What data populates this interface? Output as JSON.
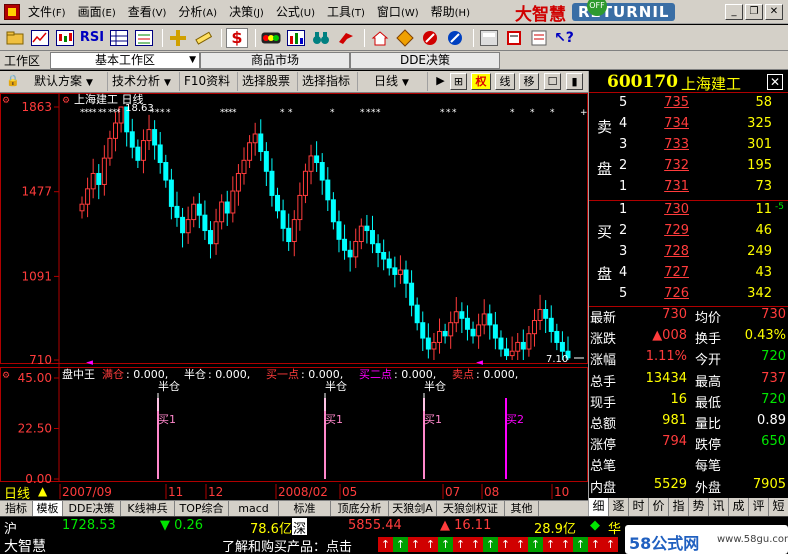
{
  "menu": {
    "items": [
      {
        "label": "文件",
        "key": "(F)"
      },
      {
        "label": "画面",
        "key": "(E)"
      },
      {
        "label": "查看",
        "key": "(V)"
      },
      {
        "label": "分析",
        "key": "(A)"
      },
      {
        "label": "决策",
        "key": "(J)"
      },
      {
        "label": "公式",
        "key": "(U)"
      },
      {
        "label": "工具",
        "key": "(T)"
      },
      {
        "label": "窗口",
        "key": "(W)"
      },
      {
        "label": "帮助",
        "key": "(H)"
      }
    ],
    "brand_text": "大智慧",
    "brand_badge": "RETURNIL",
    "off_badge": "OFF"
  },
  "toolbar": {
    "rsi_label": "RSI",
    "dollar_label": "$"
  },
  "workarea": {
    "label": "工作区",
    "tabs": [
      "基本工作区",
      "商品市场",
      "DDE决策"
    ]
  },
  "chart_toolbar": {
    "buttons": [
      "默认方案",
      "技术分析",
      "F10资料",
      "选择股票",
      "选择指标",
      "日线"
    ],
    "right_buttons": [
      "▶",
      "⊞",
      "权",
      "线",
      "移",
      "☐",
      "▮"
    ]
  },
  "chart_data": [
    {
      "type": "candlestick",
      "title": "上海建工 日线",
      "y_ticks": [
        "1863",
        "1477",
        "1091",
        "710"
      ],
      "x_ticks": [
        "2007/09",
        "11",
        "12",
        "2008/02",
        "05",
        "07",
        "08",
        "10"
      ],
      "annotations": [
        {
          "label": "18.63",
          "at": "high"
        },
        {
          "label": "7.10",
          "at": "low"
        }
      ],
      "ylim": [
        7.1,
        18.63
      ],
      "closes": [
        14.2,
        14.9,
        15.6,
        15.1,
        16.3,
        17.2,
        17.9,
        18.63,
        17.5,
        16.8,
        16.2,
        17.1,
        17.6,
        16.9,
        16.1,
        15.3,
        14.1,
        13.6,
        12.9,
        13.5,
        14.2,
        13.7,
        13.0,
        12.4,
        13.4,
        14.3,
        13.8,
        14.8,
        15.6,
        16.2,
        17.0,
        17.4,
        16.6,
        15.7,
        14.6,
        13.9,
        13.1,
        12.5,
        13.5,
        14.6,
        15.7,
        16.4,
        16.1,
        15.3,
        14.4,
        13.4,
        12.6,
        12.1,
        11.8,
        12.5,
        13.2,
        13.0,
        12.4,
        12.0,
        11.7,
        11.3,
        11.0,
        11.2,
        10.6,
        9.6,
        8.8,
        8.1,
        7.6,
        7.9,
        8.4,
        8.2,
        8.8,
        9.3,
        9.0,
        8.5,
        8.2,
        8.7,
        9.2,
        8.7,
        8.1,
        7.6,
        7.3,
        7.5,
        7.9,
        7.6,
        8.3,
        8.9,
        9.4,
        9.0,
        8.4,
        7.9,
        7.5,
        7.2
      ]
    },
    {
      "type": "bar",
      "title": "盘中王",
      "y_ticks": [
        "45.00",
        "22.50",
        "0.00"
      ],
      "ylim": [
        0,
        45
      ],
      "legend": [
        {
          "name": "满仓",
          "value": "0.000",
          "color": "#ff3c3c"
        },
        {
          "name": "半仓",
          "value": "0.000",
          "color": "#ffffff"
        },
        {
          "name": "买一点",
          "value": "0.000",
          "color": "#ff3c3c"
        },
        {
          "name": "买二点",
          "value": "0.000",
          "color": "#ff00ff"
        },
        {
          "name": "卖点",
          "value": "0.000",
          "color": "#ff3c3c"
        }
      ],
      "markers": [
        {
          "top": "半仓",
          "bottom": "买1",
          "value": 45,
          "color": "#ff88cc"
        },
        {
          "top": "半仓",
          "bottom": "买1",
          "value": 45,
          "color": "#ff88cc"
        },
        {
          "top": "半仓",
          "bottom": "买1",
          "value": 45,
          "color": "#ff88cc"
        },
        {
          "top": "",
          "bottom": "买2",
          "value": 45,
          "color": "#ff00ff"
        }
      ]
    }
  ],
  "bottom_tabs": [
    "指标",
    "模板",
    "DDE决策",
    "K线神兵",
    "TOP综合",
    "macd",
    "标准",
    "顶底分析",
    "天狼剑A",
    "天狼剑权证",
    "其他"
  ],
  "bottom_tabs_active": 1,
  "x_axis_label": "日线",
  "quote": {
    "code": "600170",
    "name": "上海建工",
    "sell_label": [
      "卖",
      "盘"
    ],
    "buy_label": [
      "买",
      "盘"
    ],
    "sells": [
      {
        "level": "5",
        "price": "735",
        "vol": "58"
      },
      {
        "level": "4",
        "price": "734",
        "vol": "325"
      },
      {
        "level": "3",
        "price": "733",
        "vol": "301"
      },
      {
        "level": "2",
        "price": "732",
        "vol": "195"
      },
      {
        "level": "1",
        "price": "731",
        "vol": "73"
      }
    ],
    "buys": [
      {
        "level": "1",
        "price": "730",
        "vol": "11",
        "note": "-5"
      },
      {
        "level": "2",
        "price": "729",
        "vol": "46",
        "note": ""
      },
      {
        "level": "3",
        "price": "728",
        "vol": "249",
        "note": ""
      },
      {
        "level": "4",
        "price": "727",
        "vol": "43",
        "note": ""
      },
      {
        "level": "5",
        "price": "726",
        "vol": "342",
        "note": ""
      }
    ],
    "stats": [
      {
        "k1": "最新",
        "v1": "730",
        "c1": "red",
        "k2": "均价",
        "v2": "730",
        "c2": "red"
      },
      {
        "k1": "涨跌",
        "v1": "▲008",
        "c1": "red",
        "k2": "换手",
        "v2": "0.43%",
        "c2": "yel"
      },
      {
        "k1": "涨幅",
        "v1": "1.11%",
        "c1": "red",
        "k2": "今开",
        "v2": "720",
        "c2": "green"
      },
      {
        "k1": "总手",
        "v1": "13434",
        "c1": "yel",
        "k2": "最高",
        "v2": "737",
        "c2": "red"
      },
      {
        "k1": "现手",
        "v1": "16",
        "c1": "yel",
        "k2": "最低",
        "v2": "720",
        "c2": "green"
      },
      {
        "k1": "总额",
        "v1": "981",
        "c1": "yel",
        "k2": "量比",
        "v2": "0.89",
        "c2": "wht"
      },
      {
        "k1": "涨停",
        "v1": "794",
        "c1": "red",
        "k2": "跌停",
        "v2": "650",
        "c2": "green"
      },
      {
        "k1": "总笔",
        "v1": "",
        "c1": "yel",
        "k2": "每笔",
        "v2": "",
        "c2": "yel"
      },
      {
        "k1": "内盘",
        "v1": "5529",
        "c1": "yel",
        "k2": "外盘",
        "v2": "7905",
        "c2": "yel"
      }
    ],
    "panel_tabs": [
      "细",
      "逐",
      "时",
      "价",
      "指",
      "势",
      "讯",
      "成",
      "评",
      "短"
    ]
  },
  "status": {
    "sh_label": "沪",
    "sh_index": "1728.53",
    "sh_change": "▼ 0.26",
    "sh_amount": "78.6亿",
    "sz_label": "深",
    "sz_index": "5855.44",
    "sz_change": "▲ 16.11",
    "sz_amount": "28.9亿",
    "next_label": "华",
    "logo": "大智慧",
    "ticker": "了解和购买产品：点击",
    "watermark": "58公式网",
    "watermark_url": "www.58gu.com"
  }
}
